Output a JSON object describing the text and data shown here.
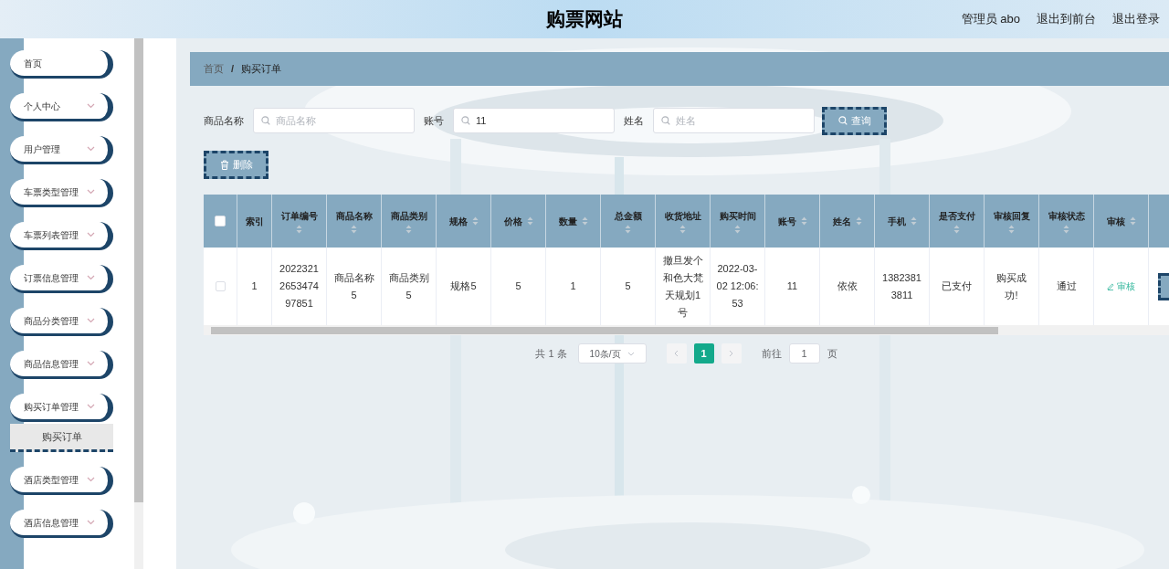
{
  "header": {
    "title": "购票网站",
    "links": [
      "管理员 abo",
      "退出到前台",
      "退出登录"
    ]
  },
  "sidebar": {
    "items": [
      {
        "label": "首页",
        "expandable": false
      },
      {
        "label": "个人中心",
        "expandable": true
      },
      {
        "label": "用户管理",
        "expandable": true
      },
      {
        "label": "车票类型管理",
        "expandable": true
      },
      {
        "label": "车票列表管理",
        "expandable": true
      },
      {
        "label": "订票信息管理",
        "expandable": true
      },
      {
        "label": "商品分类管理",
        "expandable": true
      },
      {
        "label": "商品信息管理",
        "expandable": true
      },
      {
        "label": "购买订单管理",
        "expandable": true,
        "children": [
          {
            "label": "购买订单",
            "selected": true
          }
        ]
      },
      {
        "label": "酒店类型管理",
        "expandable": true
      },
      {
        "label": "酒店信息管理",
        "expandable": true
      }
    ]
  },
  "breadcrumb": {
    "separator": "/",
    "items": [
      "首页",
      "购买订单"
    ]
  },
  "search": {
    "fields": [
      {
        "label": "商品名称",
        "placeholder": "商品名称"
      },
      {
        "label": "账号",
        "value": "11"
      },
      {
        "label": "姓名",
        "placeholder": "姓名"
      }
    ],
    "button": "查询"
  },
  "delete_button": "删除",
  "table": {
    "select_all_checked": false,
    "columns": [
      {
        "label": "索引",
        "sortable": false
      },
      {
        "label": "订单编号",
        "sortable": true
      },
      {
        "label": "商品名称",
        "sortable": true
      },
      {
        "label": "商品类别",
        "sortable": true
      },
      {
        "label": "规格",
        "sortable": true
      },
      {
        "label": "价格",
        "sortable": true
      },
      {
        "label": "数量",
        "sortable": true
      },
      {
        "label": "总金额",
        "sortable": true
      },
      {
        "label": "收货地址",
        "sortable": true
      },
      {
        "label": "购买时间",
        "sortable": true
      },
      {
        "label": "账号",
        "sortable": true
      },
      {
        "label": "姓名",
        "sortable": true
      },
      {
        "label": "手机",
        "sortable": true
      },
      {
        "label": "是否支付",
        "sortable": true
      },
      {
        "label": "审核回复",
        "sortable": true
      },
      {
        "label": "审核状态",
        "sortable": true
      },
      {
        "label": "审核",
        "sortable": true
      }
    ],
    "rows": [
      {
        "checked": false,
        "cells": [
          "1",
          "2022321265347497851",
          "商品名称5",
          "商品类别5",
          "规格5",
          "5",
          "1",
          "5",
          "撤旦发个和色大梵天规划1号",
          "2022-03-02 12:06:53",
          "11",
          "依依",
          "13823813811",
          "已支付",
          "购买成功!",
          "通过"
        ],
        "action": "审核"
      }
    ]
  },
  "pagination": {
    "total": "共 1 条",
    "page_size": "10条/页",
    "pages": [
      {
        "label": "1",
        "selected": true
      }
    ],
    "goto_label": "前往",
    "goto_value": "1",
    "page_suffix": "页"
  }
}
